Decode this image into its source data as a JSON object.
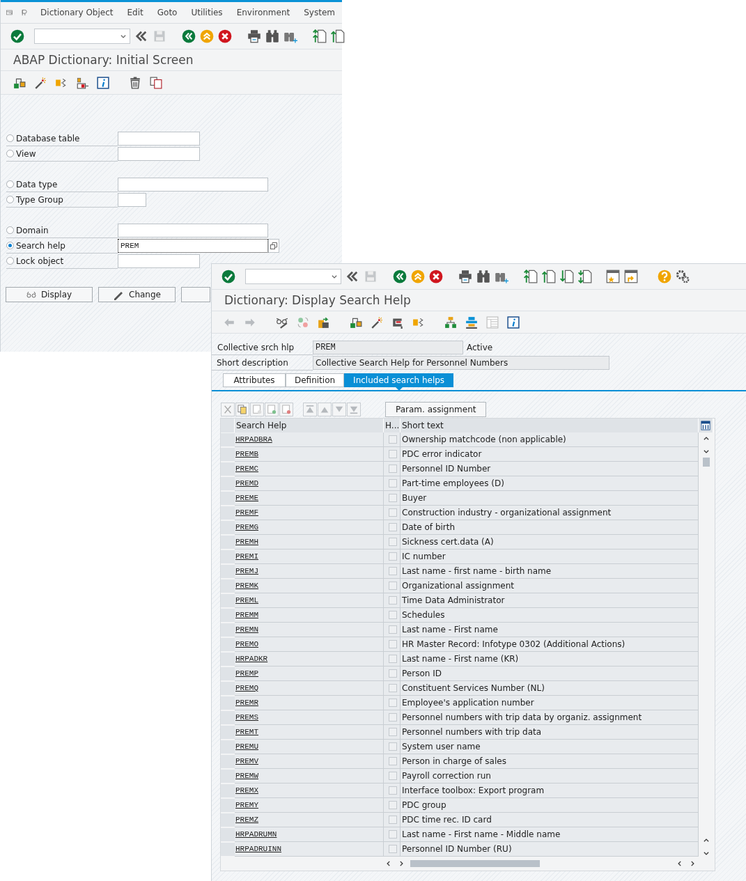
{
  "initial_screen": {
    "menu": [
      {
        "label": "Dictionary Object"
      },
      {
        "label": "Edit"
      },
      {
        "label": "Goto"
      },
      {
        "label": "Utilities"
      },
      {
        "label": "Environment"
      },
      {
        "label": "System"
      }
    ],
    "title": "ABAP Dictionary: Initial Screen",
    "groups": [
      {
        "fields": [
          {
            "label": "Database table",
            "selected": false
          },
          {
            "label": "View",
            "selected": false
          }
        ]
      },
      {
        "fields": [
          {
            "label": "Data type",
            "selected": false
          },
          {
            "label": "Type Group",
            "selected": false
          }
        ]
      },
      {
        "fields": [
          {
            "label": "Domain",
            "selected": false
          },
          {
            "label": "Search help",
            "selected": true,
            "value": "PREM"
          },
          {
            "label": "Lock object",
            "selected": false
          }
        ]
      }
    ],
    "buttons": [
      {
        "label": "Display",
        "kind": "display"
      },
      {
        "label": "Change",
        "kind": "change"
      }
    ]
  },
  "display_window": {
    "title": "Dictionary: Display Search Help",
    "header": {
      "name_label": "Collective srch hlp",
      "name_value": "PREM",
      "status": "Active",
      "description_label": "Short description",
      "description_value": "Collective Search Help for Personnel Numbers"
    },
    "tabs": [
      {
        "label": "Attributes",
        "selected": false
      },
      {
        "label": "Definition",
        "selected": false
      },
      {
        "label": "Included search helps",
        "selected": true
      }
    ],
    "param_button": "Param. assignment",
    "columns": [
      "Search Help",
      "H...",
      "Short text"
    ],
    "rows": [
      {
        "search_help": "HRPADBRA",
        "checked": false,
        "short_text": "Ownership matchcode (non applicable)"
      },
      {
        "search_help": "PREMB",
        "checked": false,
        "short_text": "PDC error indicator"
      },
      {
        "search_help": "PREMC",
        "checked": false,
        "short_text": "Personnel ID Number"
      },
      {
        "search_help": "PREMD",
        "checked": false,
        "short_text": "Part-time employees (D)"
      },
      {
        "search_help": "PREME",
        "checked": false,
        "short_text": "Buyer"
      },
      {
        "search_help": "PREMF",
        "checked": false,
        "short_text": "Construction industry - organizational assignment"
      },
      {
        "search_help": "PREMG",
        "checked": false,
        "short_text": "Date of birth"
      },
      {
        "search_help": "PREMH",
        "checked": false,
        "short_text": "Sickness cert.data (A)"
      },
      {
        "search_help": "PREMI",
        "checked": false,
        "short_text": "IC number"
      },
      {
        "search_help": "PREMJ",
        "checked": false,
        "short_text": "Last name - first name - birth name"
      },
      {
        "search_help": "PREMK",
        "checked": false,
        "short_text": "Organizational assignment"
      },
      {
        "search_help": "PREML",
        "checked": false,
        "short_text": "Time Data Administrator"
      },
      {
        "search_help": "PREMM",
        "checked": false,
        "short_text": "Schedules"
      },
      {
        "search_help": "PREMN",
        "checked": false,
        "short_text": "Last name - First name"
      },
      {
        "search_help": "PREMO",
        "checked": false,
        "short_text": "HR Master Record: Infotype 0302 (Additional Actions)"
      },
      {
        "search_help": "HRPADKR",
        "checked": false,
        "short_text": "Last name - First name (KR)"
      },
      {
        "search_help": "PREMP",
        "checked": false,
        "short_text": "Person ID"
      },
      {
        "search_help": "PREMQ",
        "checked": false,
        "short_text": "Constituent Services Number (NL)"
      },
      {
        "search_help": "PREMR",
        "checked": false,
        "short_text": "Employee's application number"
      },
      {
        "search_help": "PREMS",
        "checked": false,
        "short_text": "Personnel numbers with trip data by organiz. assignment"
      },
      {
        "search_help": "PREMT",
        "checked": false,
        "short_text": "Personnel numbers with trip data"
      },
      {
        "search_help": "PREMU",
        "checked": false,
        "short_text": "System user name"
      },
      {
        "search_help": "PREMV",
        "checked": false,
        "short_text": "Person in charge of sales"
      },
      {
        "search_help": "PREMW",
        "checked": false,
        "short_text": "Payroll correction run"
      },
      {
        "search_help": "PREMX",
        "checked": false,
        "short_text": "Interface toolbox: Export program"
      },
      {
        "search_help": "PREMY",
        "checked": false,
        "short_text": "PDC group"
      },
      {
        "search_help": "PREMZ",
        "checked": false,
        "short_text": "PDC time rec. ID card"
      },
      {
        "search_help": "HRPADRUMN",
        "checked": false,
        "short_text": "Last name - First name - Middle name"
      },
      {
        "search_help": "HRPADRUINN",
        "checked": false,
        "short_text": "Personnel ID Number (RU)"
      }
    ]
  }
}
